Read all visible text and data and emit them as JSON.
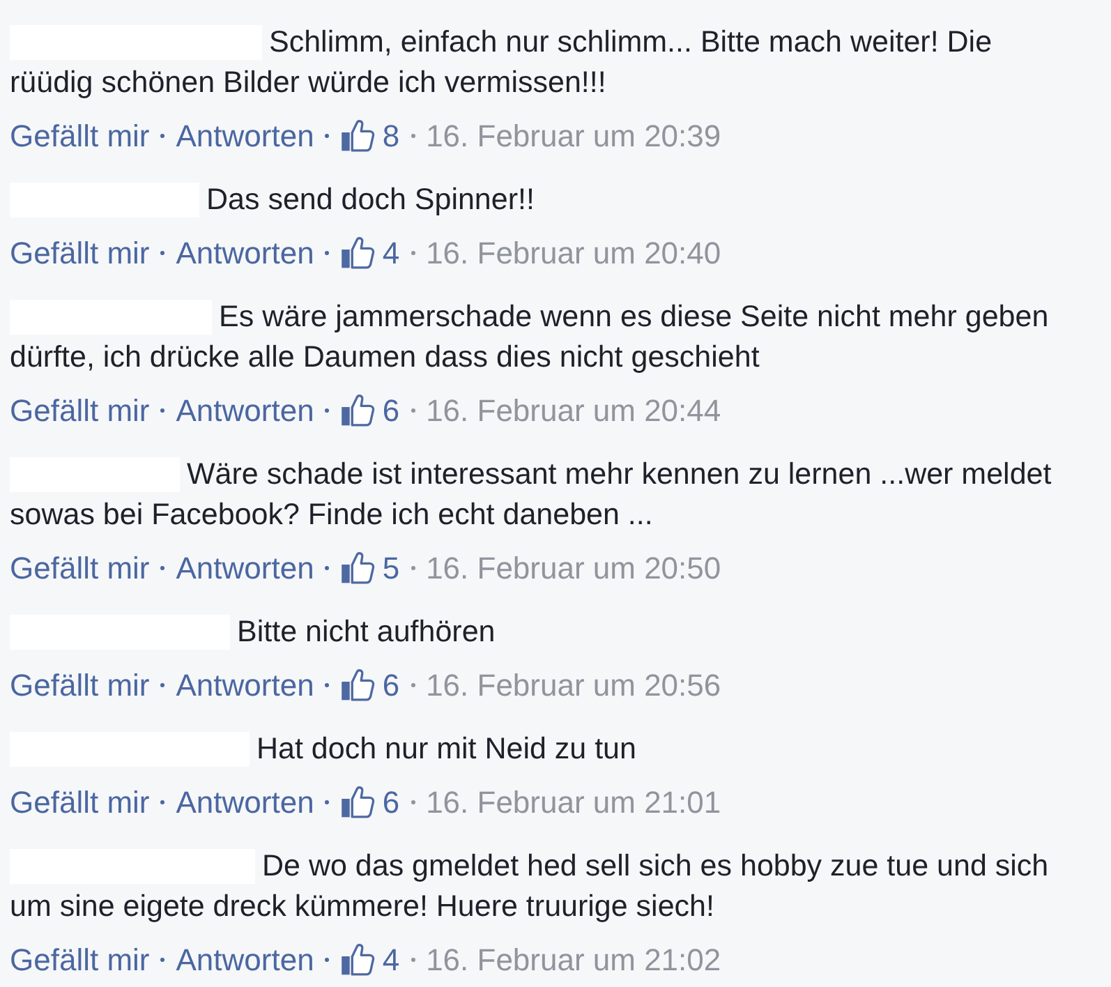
{
  "comments": [
    {
      "lines": [
        "Schlimm, einfach nur schlimm... Bitte mach weiter! Die",
        "rüüdig schönen Bilder würde ich vermissen!!!"
      ],
      "like": "Gefällt mir",
      "reply": "Antworten",
      "likes": "8",
      "date": "16. Februar um 20:39"
    },
    {
      "lines": [
        "Das send doch Spinner!!"
      ],
      "like": "Gefällt mir",
      "reply": "Antworten",
      "likes": "4",
      "date": "16. Februar um 20:40"
    },
    {
      "lines": [
        "Es wäre jammerschade wenn es diese Seite nicht mehr geben",
        "dürfte, ich drücke alle Daumen dass dies nicht geschieht"
      ],
      "like": "Gefällt mir",
      "reply": "Antworten",
      "likes": "6",
      "date": "16. Februar um 20:44"
    },
    {
      "lines": [
        "Wäre schade ist interessant mehr kennen zu lernen ...wer meldet",
        "sowas bei Facebook? Finde ich echt daneben ..."
      ],
      "like": "Gefällt mir",
      "reply": "Antworten",
      "likes": "5",
      "date": "16. Februar um 20:50"
    },
    {
      "lines": [
        "Bitte nicht aufhören"
      ],
      "like": "Gefällt mir",
      "reply": "Antworten",
      "likes": "6",
      "date": "16. Februar um 20:56"
    },
    {
      "lines": [
        "Hat doch nur mit Neid zu tun"
      ],
      "like": "Gefällt mir",
      "reply": "Antworten",
      "likes": "6",
      "date": "16. Februar um 21:01"
    },
    {
      "lines": [
        "De wo das gmeldet hed sell sich es hobby zue tue und sich",
        "um sine eigete dreck kümmere! Huere truurige siech!"
      ],
      "like": "Gefällt mir",
      "reply": "Antworten",
      "likes": "4",
      "date": "16. Februar um 21:02"
    }
  ]
}
